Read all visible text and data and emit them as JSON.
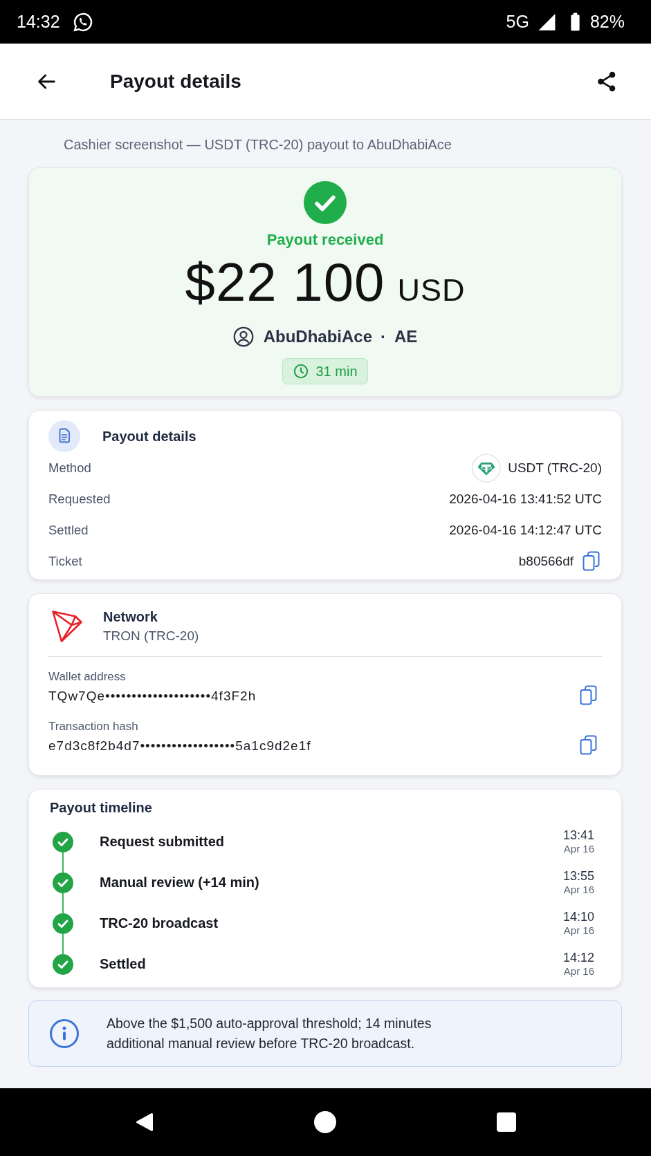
{
  "status_bar": {
    "time": "14:32",
    "network": "5G",
    "battery": "82%"
  },
  "app_bar": {
    "title": "Payout details"
  },
  "caption": "Cashier screenshot — USDT (TRC-20) payout to AbuDhabiAce",
  "summary": {
    "status": "Payout received",
    "amount": "$22 100",
    "currency": "USD",
    "user": "AbuDhabiAce",
    "separator": "·",
    "country": "AE",
    "duration": "31 min"
  },
  "details": {
    "title": "Payout details",
    "rows": [
      {
        "kind": "method",
        "label": "Method",
        "value": "USDT (TRC-20)"
      },
      {
        "kind": "text",
        "label": "Requested",
        "value": "2026-04-16 13:41:52 UTC"
      },
      {
        "kind": "text",
        "label": "Settled",
        "value": "2026-04-16 14:12:47 UTC"
      },
      {
        "kind": "copy",
        "label": "Ticket",
        "value": "b80566df"
      }
    ]
  },
  "network": {
    "title": "Network",
    "name": "TRON (TRC-20)",
    "fields": [
      {
        "label": "Wallet address",
        "value": "TQw7Qe••••••••••••••••••••4f3F2h"
      },
      {
        "label": "Transaction hash",
        "value": "e7d3c8f2b4d7••••••••••••••••••5a1c9d2e1f"
      }
    ]
  },
  "timeline": {
    "title": "Payout timeline",
    "steps": [
      {
        "label": "Request submitted",
        "time": "13:41",
        "date": "Apr 16",
        "done": true
      },
      {
        "label": "Manual review (+14 min)",
        "time": "13:55",
        "date": "Apr 16",
        "done": true
      },
      {
        "label": "TRC-20 broadcast",
        "time": "14:10",
        "date": "Apr 16",
        "done": true
      },
      {
        "label": "Settled",
        "time": "14:12",
        "date": "Apr 16",
        "done": true
      }
    ]
  },
  "notice": {
    "text": "Above the $1,500 auto-approval threshold; 14 minutes additional manual review before TRC-20 broadcast."
  }
}
